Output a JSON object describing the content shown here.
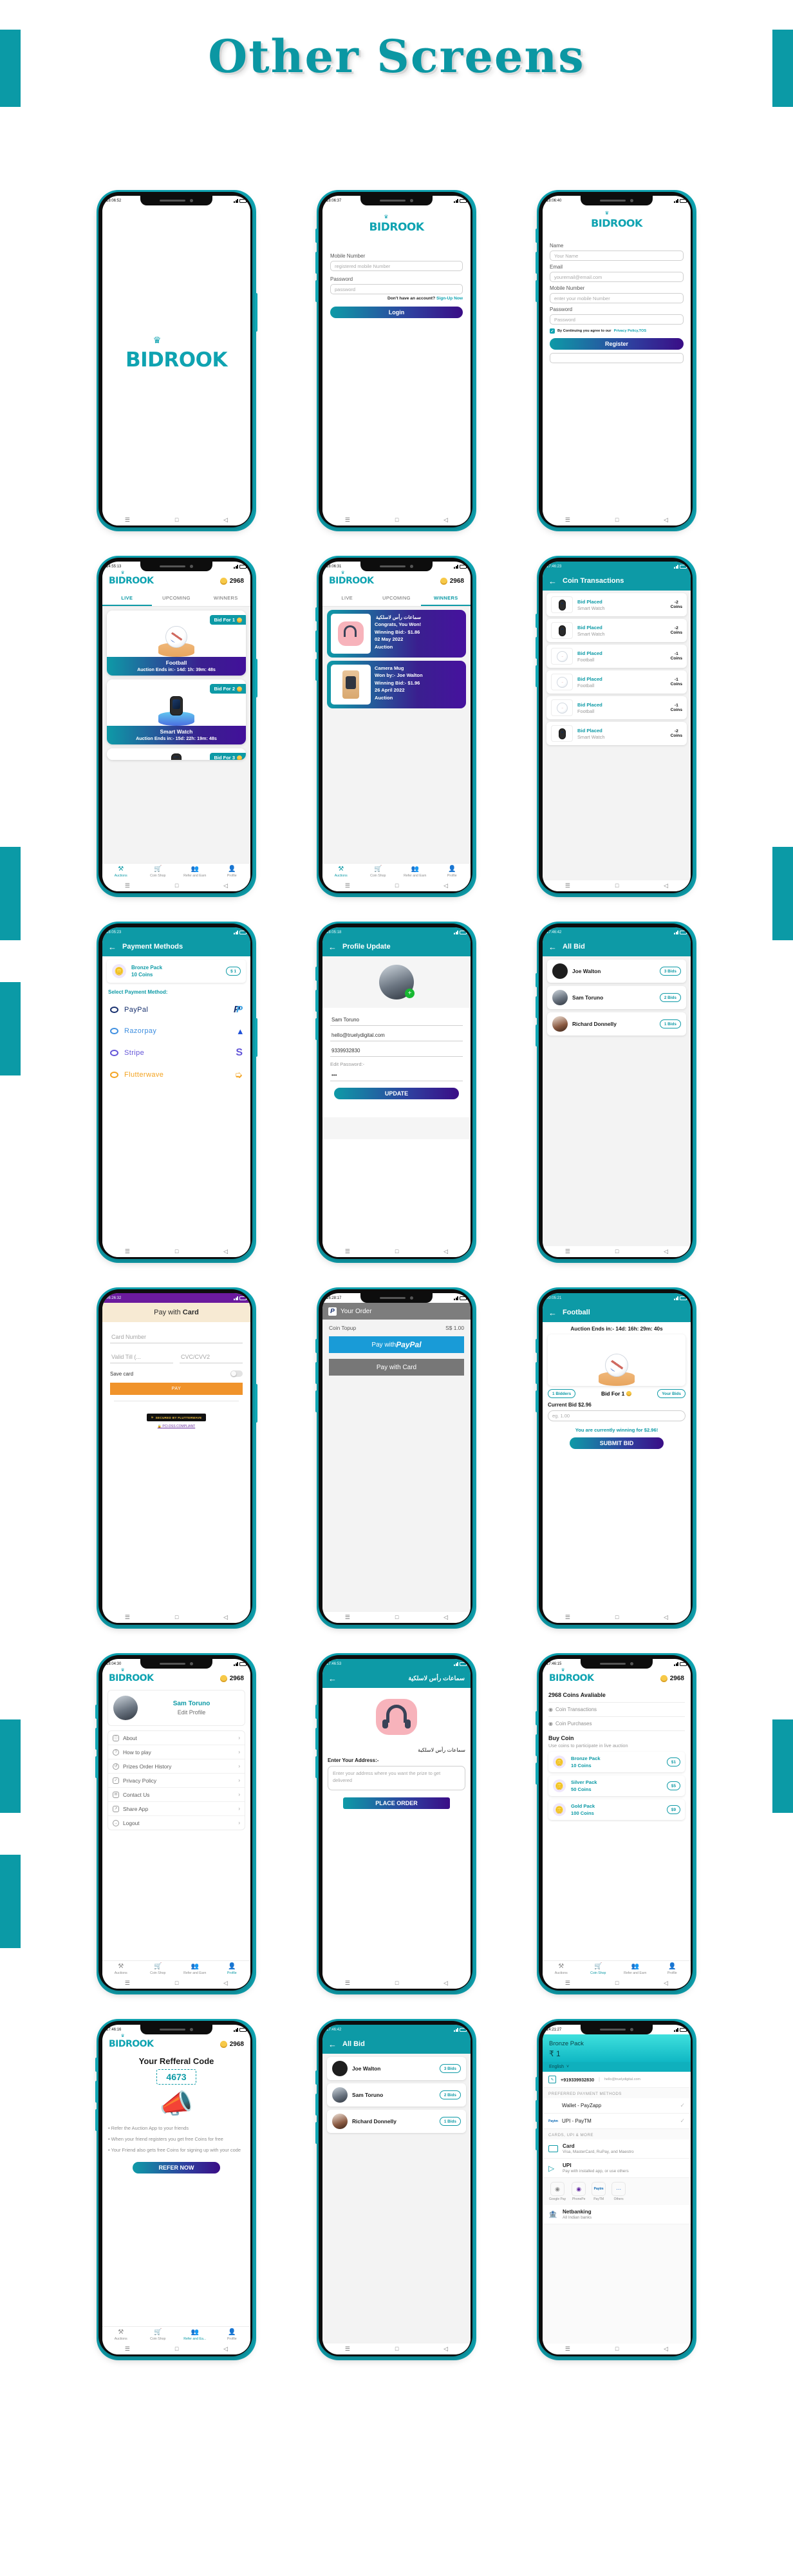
{
  "page": {
    "title": "Other Screens",
    "accent": "#0b97a3"
  },
  "nav": {
    "menu": "☰",
    "home": "□",
    "back": "◁"
  },
  "brand": {
    "name": "BIDROOK",
    "crown": "♛",
    "coins": "2968"
  },
  "tabbar": {
    "auctions": "Auctions",
    "coin_shop": "Coin Shop",
    "refer": "Refer and Earn",
    "refer_short": "Refer and Ea...",
    "profile": "Profile"
  },
  "screens": {
    "splash": {
      "time": "18:06:52"
    },
    "login": {
      "time": "18:06:37",
      "mobile_label": "Mobile Number",
      "mobile_placeholder": "registered mobile Number",
      "password_label": "Password",
      "password_placeholder": "password",
      "signup_text": "Don't have an account? ",
      "signup_link": "Sign-Up Now",
      "login_button": "Login"
    },
    "register": {
      "time": "18:06:40",
      "name_label": "Name",
      "name_placeholder": "Your Name",
      "email_label": "Email",
      "email_placeholder": "youremail@email.com",
      "mobile_label": "Mobile Number",
      "mobile_placeholder": "enter your mobile Number",
      "password_label": "Password",
      "password_placeholder": "Password",
      "terms_text": "By Continuing you agree to our ",
      "terms_link": "Privacy Policy,TOS",
      "register_button": "Register"
    },
    "auctions": {
      "time": "14:55:13",
      "tabs": [
        "LIVE",
        "UPCOMING",
        "WINNERS"
      ],
      "active_tab": "LIVE",
      "cards": [
        {
          "title": "Football",
          "chip": "Bid For 1",
          "timer": "Auction Ends in:- 14d: 1h: 39m: 48s"
        },
        {
          "title": "Smart Watch",
          "chip": "Bid For 2",
          "timer": "Auction Ends in:- 15d: 22h: 19m: 48s"
        },
        {
          "title": "",
          "chip": "Bid For 3",
          "timer": ""
        }
      ]
    },
    "winners": {
      "time": "18:06:31",
      "tabs": [
        "LIVE",
        "UPCOMING",
        "WINNERS"
      ],
      "active_tab": "WINNERS",
      "items": [
        {
          "title": "سماعات رأس لاسلكية",
          "rtl": true,
          "line1": "Congrats, You Won!",
          "line2": "Winning Bid:- $1.86",
          "line3": "02 May 2022",
          "line4": "Auction"
        },
        {
          "title": "Camera Mug",
          "rtl": false,
          "line1": "Won by:- Joe Walton",
          "line2": "Winning Bid:- $1.96",
          "line3": "26 April 2022",
          "line4": "Auction"
        }
      ]
    },
    "coin_transactions": {
      "time": "17:46:23",
      "title": "Coin Transactions",
      "rows": [
        {
          "action": "Bid Placed",
          "item": "Smart Watch",
          "amount": "-2",
          "unit": "Coins"
        },
        {
          "action": "Bid Placed",
          "item": "Smart Watch",
          "amount": "-2",
          "unit": "Coins"
        },
        {
          "action": "Bid Placed",
          "item": "Football",
          "amount": "-1",
          "unit": "Coins"
        },
        {
          "action": "Bid Placed",
          "item": "Football",
          "amount": "-1",
          "unit": "Coins"
        },
        {
          "action": "Bid Placed",
          "item": "Football",
          "amount": "-1",
          "unit": "Coins"
        },
        {
          "action": "Bid Placed",
          "item": "Smart Watch",
          "amount": "-2",
          "unit": "Coins"
        }
      ]
    },
    "payment_methods": {
      "time": "18:05:23",
      "title": "Payment Methods",
      "pack_name": "Bronze Pack",
      "pack_coins": "10 Coins",
      "pack_price": "$ 1",
      "select_label": "Select Payment Method:",
      "methods": [
        {
          "name": "PayPal",
          "color": "#17306e"
        },
        {
          "name": "Razorpay",
          "color": "#3f8fe0"
        },
        {
          "name": "Stripe",
          "color": "#6355d8"
        },
        {
          "name": "Flutterwave",
          "color": "#f3a320"
        }
      ]
    },
    "profile_update": {
      "time": "18:05:18",
      "title": "Profile Update",
      "name": "Sam Toruno",
      "email": "hello@truelydigital.com",
      "mobile": "9339932830",
      "password_label": "Edit Password:-",
      "password_value": "•••",
      "update_button": "UPDATE"
    },
    "all_bid": {
      "time": "17:46:42",
      "title": "All Bid",
      "rows": [
        {
          "name": "Joe Walton",
          "bids": "3 Bids"
        },
        {
          "name": "Sam Toruno",
          "bids": "2 Bids"
        },
        {
          "name": "Richard Donnelly",
          "bids": "1 Bids"
        }
      ]
    },
    "pay_card": {
      "time": "06:26:32",
      "title_prefix": "Pay with ",
      "title_bold": "Card",
      "card_placeholder": "Card Number",
      "valid_placeholder": "Valid Till (...",
      "cvc_placeholder": "CVC/CVV2",
      "save_label": "Save card",
      "pay_button": "PAY",
      "secured": "SECURED BY FLUTTERWAVE",
      "compliant": "PCI-DSS COMPLIANT"
    },
    "paypal_order": {
      "time": "16:28:17",
      "title": "Your Order",
      "item": "Coin Topup",
      "amount": "S$ 1.00",
      "paypal_button_prefix": "Pay with ",
      "paypal_button_brand": "PayPal",
      "card_button": "Pay with Card"
    },
    "football_detail": {
      "time": "00:05:21",
      "title": "Football",
      "timer": "Auction Ends in:- 14d: 16h: 29m: 40s",
      "bidders": "1 Bidders",
      "bid_for": "Bid For 1",
      "your_bids": "Your Bids",
      "current_bid": "Current Bid $2.96",
      "input_placeholder": "eg. 1.00",
      "winning_text": "You are currently winning for $2.96!",
      "submit_button": "SUBMIT BID"
    },
    "profile": {
      "time": "18:04:30",
      "user_name": "Sam Toruno",
      "edit_profile": "Edit Profile",
      "menu": [
        {
          "label": "About",
          "icon": "ⓘ"
        },
        {
          "label": "How to play",
          "icon": "?"
        },
        {
          "label": "Prizes Order History",
          "icon": "↺"
        },
        {
          "label": "Privacy Policy",
          "icon": "✓"
        },
        {
          "label": "Contact Us",
          "icon": "✉"
        },
        {
          "label": "Share App",
          "icon": "↗"
        },
        {
          "label": "Logout",
          "icon": "→"
        }
      ]
    },
    "place_order": {
      "time": "17:46:53",
      "title": "سماعات رأس لاسلكية",
      "product": "سماعات رأس لاسلكية",
      "address_label": "Enter Your Address:-",
      "address_placeholder": "Enter your address where you want the prize to get delivered",
      "place_order_button": "PLACE ORDER"
    },
    "coin_shop": {
      "time": "17:46:15",
      "available": "2968 Coins Avaliable",
      "transactions_link": "Coin Transactions",
      "purchases_link": "Coin Purchases",
      "buy_title": "Buy Coin",
      "buy_subtitle": "Use coins to participate in live auction",
      "packs": [
        {
          "name": "Bronze Pack",
          "coins": "10 Coins",
          "price": "$1"
        },
        {
          "name": "Silver Pack",
          "coins": "50 Coins",
          "price": "$5"
        },
        {
          "name": "Gold Pack",
          "coins": "100 Coins",
          "price": "$9"
        }
      ]
    },
    "referral": {
      "time": "17:46:16",
      "title": "Your Refferal Code",
      "code": "4673",
      "bullets": [
        "• Refer the Auction App to your friends",
        "• When your friend registers you get free Coins for free",
        "• Your Friend also gets free Coins for signing up with your code"
      ],
      "refer_button": "REFER NOW"
    },
    "all_bid2": {
      "time": "17:46:42",
      "title": "All Bid",
      "rows": [
        {
          "name": "Joe Walton",
          "bids": "3 Bids"
        },
        {
          "name": "Sam Toruno",
          "bids": "2 Bids"
        },
        {
          "name": "Richard Donnelly",
          "bids": "1 Bids"
        }
      ]
    },
    "razorpay": {
      "time": "14:21:27",
      "pack": "Bronze Pack",
      "amount": "₹ 1",
      "language": "English",
      "phone": "+919339932830",
      "email": "hello@truelydigital.com",
      "preferred_label": "PREFERRED PAYMENT METHODS",
      "preferred": [
        {
          "name": "Wallet - PayZapp"
        },
        {
          "name": "UPI - PayTM"
        }
      ],
      "more_label": "CARDS, UPI & MORE",
      "options": [
        {
          "name": "Card",
          "desc": "Visa, MasterCard, RuPay, and Maestro"
        },
        {
          "name": "UPI",
          "desc": "Pay with installed app, or use others"
        },
        {
          "name": "Netbanking",
          "desc": "All Indian banks"
        }
      ],
      "upi_apps": [
        "Google Pay",
        "PhonePe",
        "PayTM",
        "Others"
      ]
    }
  }
}
